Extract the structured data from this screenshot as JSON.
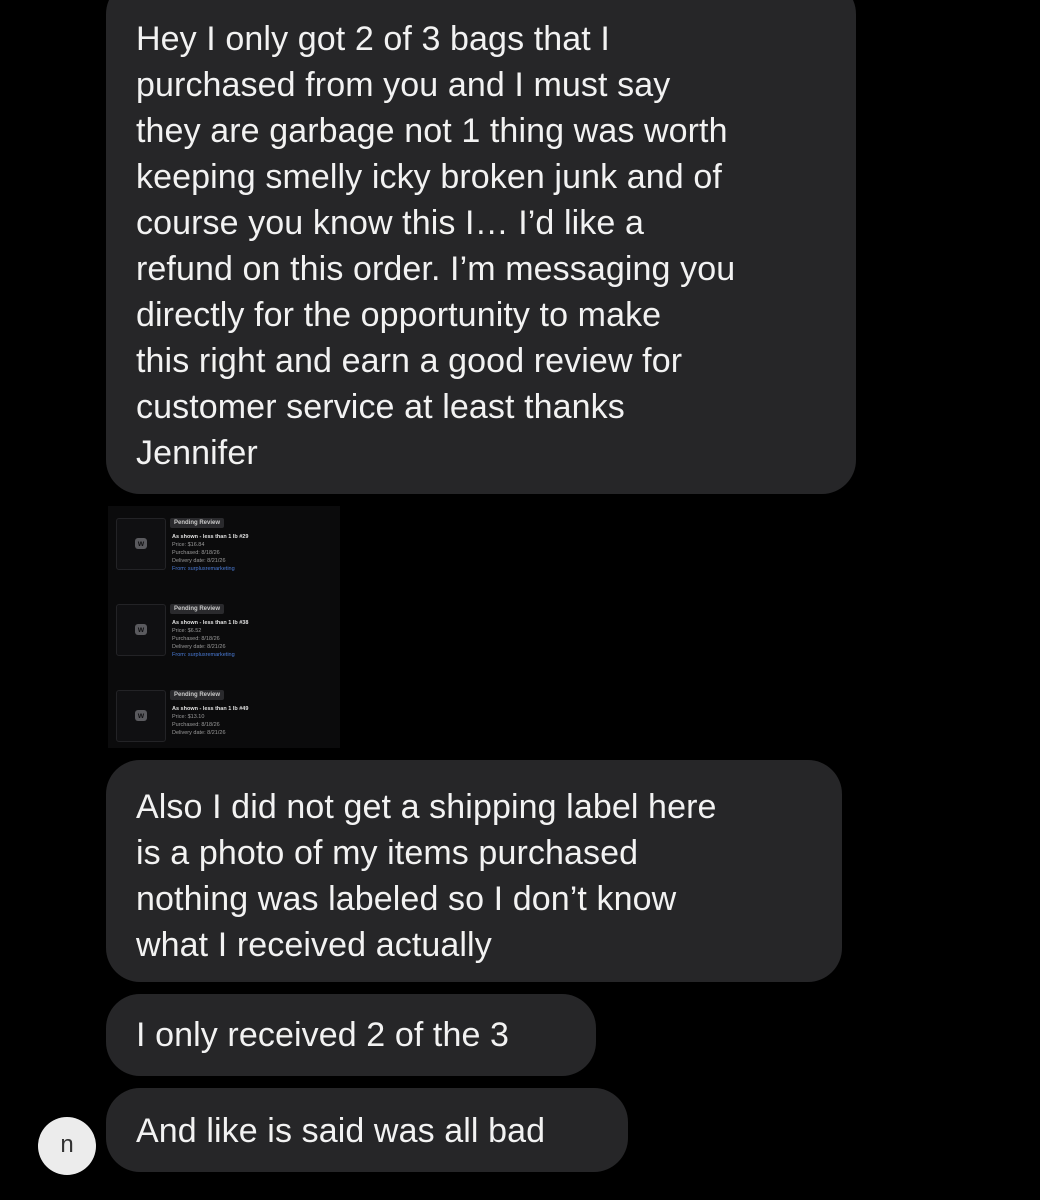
{
  "messages": [
    {
      "text": "Hey I only got 2 of 3 bags that I\npurchased from you and I must say\nthey are garbage not 1 thing was worth\nkeeping smelly icky broken junk and of\ncourse you know this I… I’d like a\nrefund on this order. I’m messaging you\ndirectly for the opportunity to make\nthis right and earn a good review for\ncustomer service at least thanks\nJennifer"
    },
    {
      "text": "Also I did not get a shipping label here\nis a photo of my items purchased\nnothing was labeled so I don’t know\nwhat I received actually"
    },
    {
      "text": "I only received 2 of the 3"
    },
    {
      "text": "And like is said was all bad"
    }
  ],
  "attachment": {
    "orders": [
      {
        "status": "Pending Review",
        "title": "As shown - less than 1 lb #29",
        "price": "Price: $16.84",
        "purchased": "Purchased: 8/18/26",
        "delivery": "Delivery date: 8/21/26",
        "from": "From: surplusremarketing"
      },
      {
        "status": "Pending Review",
        "title": "As shown - less than 1 lb #38",
        "price": "Price: $6.52",
        "purchased": "Purchased: 8/18/26",
        "delivery": "Delivery date: 8/21/26",
        "from": "From: surplusremarketing"
      },
      {
        "status": "Pending Review",
        "title": "As shown - less than 1 lb #49",
        "price": "Price: $13.10",
        "purchased": "Purchased: 8/18/26",
        "delivery": "Delivery date: 8/21/26",
        "from": ""
      }
    ]
  },
  "avatar": {
    "initial": "n"
  },
  "colors": {
    "background": "#000000",
    "bubble": "#262628",
    "text": "#f2f2f2",
    "link": "#4a7bd6",
    "avatar_bg": "#ececec"
  }
}
